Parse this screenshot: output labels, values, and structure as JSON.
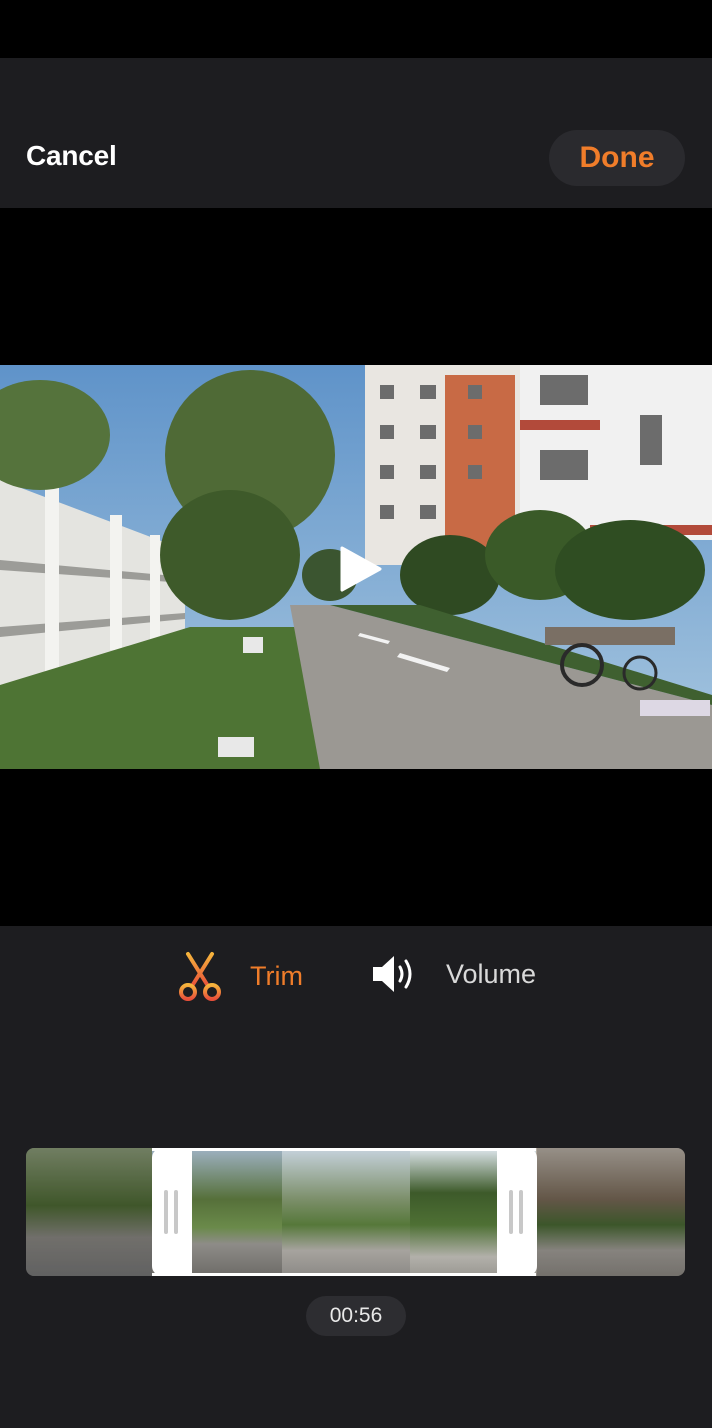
{
  "header": {
    "cancel_label": "Cancel",
    "done_label": "Done"
  },
  "video": {
    "state": "paused",
    "play_icon": "play-icon"
  },
  "tools": {
    "trim": {
      "label": "Trim",
      "icon": "scissors-icon",
      "active": true
    },
    "volume": {
      "label": "Volume",
      "icon": "speaker-icon",
      "active": false
    }
  },
  "timeline": {
    "duration": "00:56",
    "frame_count": 7
  },
  "colors": {
    "accent": "#f07d2a",
    "panel": "#1d1d20",
    "button_bg": "#2a2a2e"
  }
}
